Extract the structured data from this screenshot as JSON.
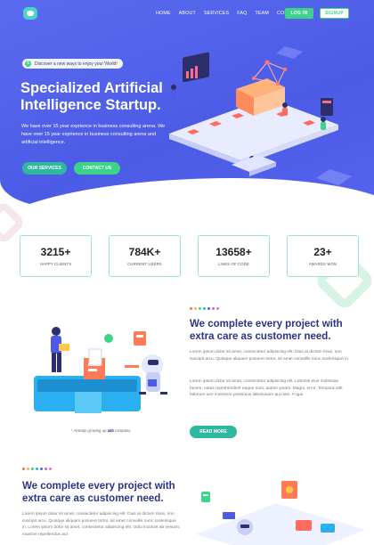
{
  "header": {
    "nav": [
      "HOME",
      "ABOUT",
      "SERVICES",
      "FAQ",
      "TEAM",
      "CONTACT"
    ],
    "login_label": "LOG IN",
    "signup_label": "SIGNUP"
  },
  "hero": {
    "pill_icon": "$",
    "pill_text": "Discover a new ways to enjoy your World!",
    "title": "Specialized Artificial Intelligence Startup.",
    "text": "We have over 15 year exprience in business consulting arena. We have over 15 year exprience in business consulting arena and artificial intelligence.",
    "btn_services": "OUR SERVICES",
    "btn_contact": "CONTACT US"
  },
  "stats": [
    {
      "value": "3215+",
      "label": "HAPPY CLIENTS"
    },
    {
      "value": "784K+",
      "label": "CURRENT USERS"
    },
    {
      "value": "13658+",
      "label": "LINES OF CODE"
    },
    {
      "value": "23+",
      "label": "AWARDS WON"
    }
  ],
  "feature1": {
    "title": "We complete every project with extra care as customer need.",
    "para1": "Lorem ipsum dolor sit amet, consectetur adipiscing elit. Duis at dictum risus, non suscipit arcu. Quisque aliquam posuere tortor, sit amet convallis nunc scelerisque in.",
    "para2": "Lorem ipsum dolor sit amet, consectetur adipiscing elit. Lobortis eius molestiae facere, natus reprehenderit eaque eum, autem ipsam. Magni, error. Tempora odit laborum iure inventore possimus laboriosam qui nam. Fuga!",
    "readmore_label": "READ MORE",
    "caption_prefix": "* Already growing up",
    "caption_count": "445",
    "caption_suffix": "company"
  },
  "feature2": {
    "title": "We complete every project with extra care as customer need.",
    "para1": "Lorem ipsum dolor sit amet, consectetur adipiscing elit. Duis at dictum risus, non suscipit arcu. Quisque aliquam posuere tortor, sit amet convallis nunc scelerisque in. Lorem ipsum dolor sit amet, consectetur adipiscing elit. Odio incidunt ab veniam, maxime repellendus aut"
  },
  "colors": {
    "primary": "#4c5be6",
    "accent": "#3ed38a",
    "teal": "#2fb7a0",
    "heading": "#2a3489"
  }
}
